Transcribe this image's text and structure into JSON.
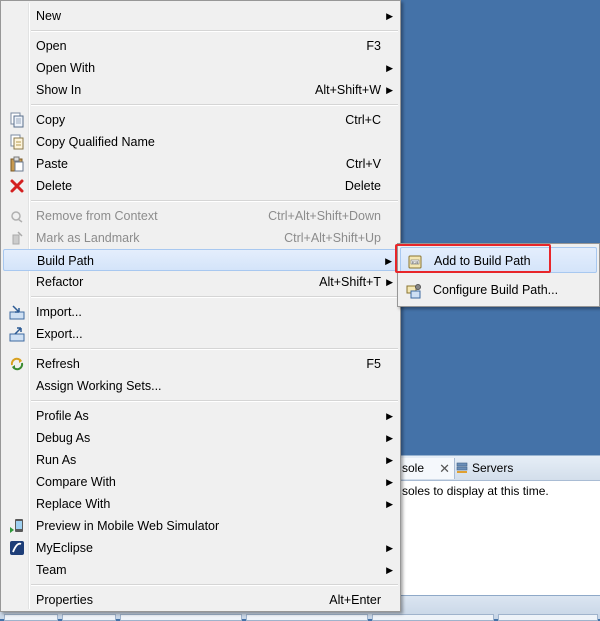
{
  "menu": {
    "items": [
      {
        "id": "new",
        "label": "New",
        "shortcut": "",
        "submenu": true,
        "icon": null
      },
      {
        "id": "open",
        "label": "Open",
        "shortcut": "F3",
        "submenu": false,
        "icon": null
      },
      {
        "id": "open-with",
        "label": "Open With",
        "shortcut": "",
        "submenu": true,
        "icon": null
      },
      {
        "id": "show-in",
        "label": "Show In",
        "shortcut": "Alt+Shift+W",
        "submenu": true,
        "icon": null
      },
      {
        "id": "copy",
        "label": "Copy",
        "shortcut": "Ctrl+C",
        "submenu": false,
        "icon": "copy-icon"
      },
      {
        "id": "copy-qualified-name",
        "label": "Copy Qualified Name",
        "shortcut": "",
        "submenu": false,
        "icon": "copy-qualified-name-icon"
      },
      {
        "id": "paste",
        "label": "Paste",
        "shortcut": "Ctrl+V",
        "submenu": false,
        "icon": "paste-icon"
      },
      {
        "id": "delete",
        "label": "Delete",
        "shortcut": "Delete",
        "submenu": false,
        "icon": "delete-icon"
      },
      {
        "id": "remove-from-context",
        "label": "Remove from Context",
        "shortcut": "Ctrl+Alt+Shift+Down",
        "submenu": false,
        "icon": "remove-context-icon",
        "disabled": true
      },
      {
        "id": "mark-as-landmark",
        "label": "Mark as Landmark",
        "shortcut": "Ctrl+Alt+Shift+Up",
        "submenu": false,
        "icon": "landmark-icon",
        "disabled": true
      },
      {
        "id": "build-path",
        "label": "Build Path",
        "shortcut": "",
        "submenu": true,
        "icon": null,
        "active": true
      },
      {
        "id": "refactor",
        "label": "Refactor",
        "shortcut": "Alt+Shift+T",
        "submenu": true,
        "icon": null
      },
      {
        "id": "import",
        "label": "Import...",
        "shortcut": "",
        "submenu": false,
        "icon": "import-icon"
      },
      {
        "id": "export",
        "label": "Export...",
        "shortcut": "",
        "submenu": false,
        "icon": "export-icon"
      },
      {
        "id": "refresh",
        "label": "Refresh",
        "shortcut": "F5",
        "submenu": false,
        "icon": "refresh-icon"
      },
      {
        "id": "assign-working-sets",
        "label": "Assign Working Sets...",
        "shortcut": "",
        "submenu": false,
        "icon": null
      },
      {
        "id": "profile-as",
        "label": "Profile As",
        "shortcut": "",
        "submenu": true,
        "icon": null
      },
      {
        "id": "debug-as",
        "label": "Debug As",
        "shortcut": "",
        "submenu": true,
        "icon": null
      },
      {
        "id": "run-as",
        "label": "Run As",
        "shortcut": "",
        "submenu": true,
        "icon": null
      },
      {
        "id": "compare-with",
        "label": "Compare With",
        "shortcut": "",
        "submenu": true,
        "icon": null
      },
      {
        "id": "replace-with",
        "label": "Replace With",
        "shortcut": "",
        "submenu": true,
        "icon": null
      },
      {
        "id": "preview-mobile",
        "label": "Preview in Mobile Web Simulator",
        "shortcut": "",
        "submenu": false,
        "icon": "mobile-simulator-icon"
      },
      {
        "id": "myeclipse",
        "label": "MyEclipse",
        "shortcut": "",
        "submenu": true,
        "icon": "myeclipse-icon"
      },
      {
        "id": "team",
        "label": "Team",
        "shortcut": "",
        "submenu": true,
        "icon": null
      },
      {
        "id": "properties",
        "label": "Properties",
        "shortcut": "Alt+Enter",
        "submenu": false,
        "icon": null
      }
    ]
  },
  "submenu": {
    "items": [
      {
        "id": "add-to-build-path",
        "label": "Add to Build Path",
        "icon": "jar-icon",
        "highlighted": true
      },
      {
        "id": "configure-build-path",
        "label": "Configure Build Path...",
        "icon": "configure-build-path-icon"
      }
    ]
  },
  "console": {
    "tab_console": "sole",
    "tab_servers": "Servers",
    "message": "soles to display at this time."
  },
  "colors": {
    "highlight": "#e8262a",
    "workbench": "#4472a8"
  }
}
